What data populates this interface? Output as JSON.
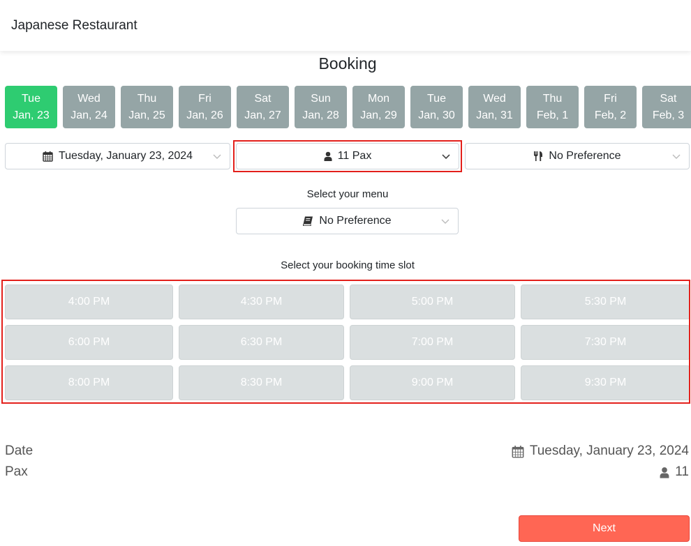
{
  "navbar": {
    "brand": "Japanese Restaurant"
  },
  "page": {
    "title": "Booking"
  },
  "date_strip": [
    {
      "day": "Tue",
      "date": "Jan, 23",
      "active": true
    },
    {
      "day": "Wed",
      "date": "Jan, 24",
      "active": false
    },
    {
      "day": "Thu",
      "date": "Jan, 25",
      "active": false
    },
    {
      "day": "Fri",
      "date": "Jan, 26",
      "active": false
    },
    {
      "day": "Sat",
      "date": "Jan, 27",
      "active": false
    },
    {
      "day": "Sun",
      "date": "Jan, 28",
      "active": false
    },
    {
      "day": "Mon",
      "date": "Jan, 29",
      "active": false
    },
    {
      "day": "Tue",
      "date": "Jan, 30",
      "active": false
    },
    {
      "day": "Wed",
      "date": "Jan, 31",
      "active": false
    },
    {
      "day": "Thu",
      "date": "Feb, 1",
      "active": false
    },
    {
      "day": "Fri",
      "date": "Feb, 2",
      "active": false
    },
    {
      "day": "Sat",
      "date": "Feb, 3",
      "active": false
    }
  ],
  "selects": {
    "date": {
      "icon": "calendar-icon",
      "value": "Tuesday, January 23, 2024"
    },
    "pax": {
      "icon": "user-icon",
      "value": "11 Pax"
    },
    "preference": {
      "icon": "utensils-icon",
      "value": "No Preference"
    },
    "menu": {
      "icon": "book-icon",
      "value": "No Preference"
    }
  },
  "labels": {
    "menu": "Select your menu",
    "time_slot": "Select your booking time slot"
  },
  "time_slots": [
    {
      "label": "4:00 PM",
      "disabled": true
    },
    {
      "label": "4:30 PM",
      "disabled": true
    },
    {
      "label": "5:00 PM",
      "disabled": true
    },
    {
      "label": "5:30 PM",
      "disabled": true
    },
    {
      "label": "6:00 PM",
      "disabled": true
    },
    {
      "label": "6:30 PM",
      "disabled": true
    },
    {
      "label": "7:00 PM",
      "disabled": true
    },
    {
      "label": "7:30 PM",
      "disabled": true
    },
    {
      "label": "8:00 PM",
      "disabled": true
    },
    {
      "label": "8:30 PM",
      "disabled": true
    },
    {
      "label": "9:00 PM",
      "disabled": true
    },
    {
      "label": "9:30 PM",
      "disabled": true
    }
  ],
  "summary": {
    "date_label": "Date",
    "date_value": "Tuesday, January 23, 2024",
    "pax_label": "Pax",
    "pax_value": "11"
  },
  "actions": {
    "next": "Next"
  },
  "colors": {
    "active_date": "#2ecc71",
    "inactive_date": "#95a5a6",
    "disabled_slot": "#dadfe0",
    "next_button": "#ff6654",
    "highlight": "#e3201b"
  }
}
